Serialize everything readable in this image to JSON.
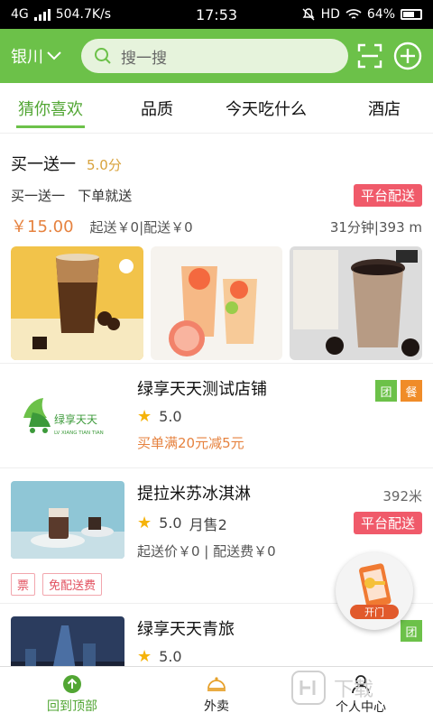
{
  "status": {
    "network": "4G",
    "speed": "504.7K/s",
    "time": "17:53",
    "hd": "HD",
    "battery": "64%"
  },
  "header": {
    "city": "银川",
    "search_placeholder": "搜一搜"
  },
  "tabs": [
    "猜你喜欢",
    "品质",
    "今天吃什么",
    "酒店"
  ],
  "featured": {
    "name": "买一送一",
    "score": "5.0分",
    "desc": "买一送一   下单就送",
    "tag": "平台配送",
    "price": "￥15.00",
    "fees": "起送￥0|配送￥0",
    "time_distance": "31分钟|393 m"
  },
  "stores": [
    {
      "name": "绿享天天测试店铺",
      "logo_text": "绿享天天",
      "logo_sub": "LV XIANG TIAN TIAN",
      "rating": "5.0",
      "promo": "买单满20元减5元",
      "badges": [
        "团",
        "餐"
      ]
    },
    {
      "name": "提拉米苏冰淇淋",
      "distance": "392米",
      "rating": "5.0",
      "sales": "月售2",
      "tag": "平台配送",
      "fees": "起送价￥0 | 配送费￥0",
      "pills": [
        "票",
        "免配送费"
      ]
    },
    {
      "name": "绿享天天青旅",
      "rating": "5.0",
      "badges": [
        "团"
      ]
    }
  ],
  "float_button": {
    "label": "开门"
  },
  "bottom_nav": [
    "回到顶部",
    "外卖",
    "个人中心"
  ],
  "watermark": "下载",
  "colors": {
    "brand_green": "#6cc149",
    "active_tab": "#52a634",
    "price_orange": "#e6823f",
    "tag_red": "#f05a6a",
    "star": "#f5b30a"
  }
}
